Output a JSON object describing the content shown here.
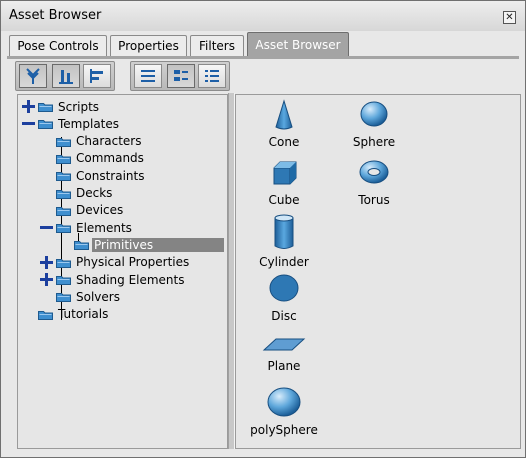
{
  "window": {
    "title": "Asset Browser"
  },
  "tabs": [
    {
      "label": "Pose Controls"
    },
    {
      "label": "Properties"
    },
    {
      "label": "Filters"
    },
    {
      "label": "Asset Browser",
      "active": true
    }
  ],
  "toolbar": {
    "view_icons": [
      "tree-icon",
      "bottom-align-icon",
      "left-align-icon"
    ],
    "list_icons": [
      "list-view-icon",
      "icon-view-icon",
      "detail-list-icon"
    ]
  },
  "tree": [
    {
      "label": "Scripts",
      "level": 0,
      "expander": "plus"
    },
    {
      "label": "Templates",
      "level": 0,
      "expander": "minus"
    },
    {
      "label": "Characters",
      "level": 1
    },
    {
      "label": "Commands",
      "level": 1
    },
    {
      "label": "Constraints",
      "level": 1
    },
    {
      "label": "Decks",
      "level": 1
    },
    {
      "label": "Devices",
      "level": 1
    },
    {
      "label": "Elements",
      "level": 1,
      "expander": "minus"
    },
    {
      "label": "Primitives",
      "level": 2,
      "selected": true
    },
    {
      "label": "Physical Properties",
      "level": 1,
      "expander": "plus"
    },
    {
      "label": "Shading Elements",
      "level": 1,
      "expander": "plus"
    },
    {
      "label": "Solvers",
      "level": 1
    },
    {
      "label": "Tutorials",
      "level": 0
    }
  ],
  "assets": [
    {
      "label": "Cone",
      "icon": "cone-icon"
    },
    {
      "label": "Sphere",
      "icon": "sphere-icon"
    },
    {
      "label": "Cube",
      "icon": "cube-icon"
    },
    {
      "label": "Torus",
      "icon": "torus-icon"
    },
    {
      "label": "Cylinder",
      "icon": "cylinder-icon"
    },
    {
      "label": "Disc",
      "icon": "disc-icon"
    },
    {
      "label": "Plane",
      "icon": "plane-icon"
    },
    {
      "label": "polySphere",
      "icon": "polysphere-icon"
    }
  ],
  "colors": {
    "selection": "#848484",
    "expander": "#1c3f9e",
    "folder": "#3f8fcf",
    "asset_fill": "#2e78b4"
  }
}
